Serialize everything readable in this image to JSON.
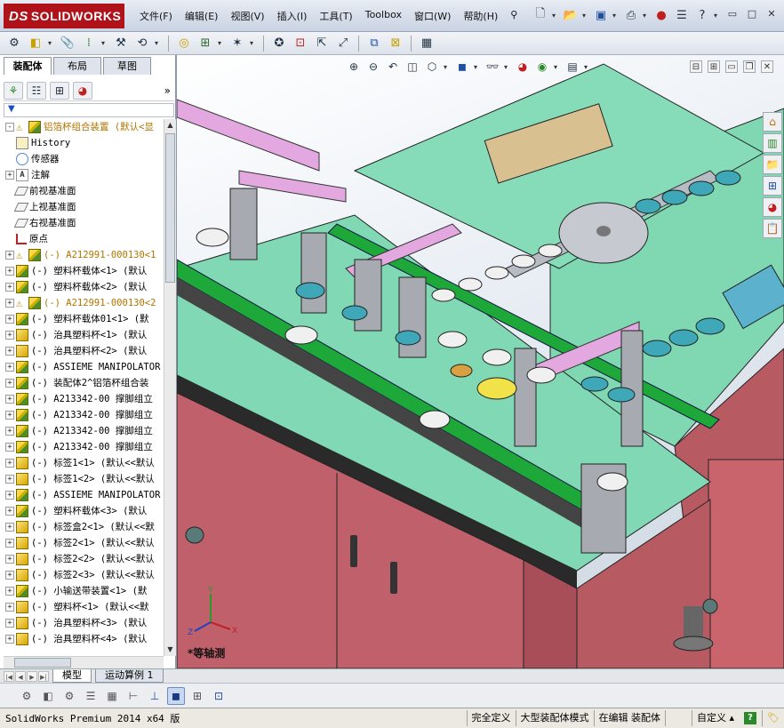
{
  "app": {
    "logo_text": "SOLIDWORKS",
    "logo_prefix": "DS"
  },
  "menu": [
    "文件(F)",
    "编辑(E)",
    "视图(V)",
    "插入(I)",
    "工具(T)",
    "Toolbox",
    "窗口(W)",
    "帮助(H)"
  ],
  "feature_manager": {
    "tabs": [
      "装配体",
      "布局",
      "草图"
    ],
    "filter_symbol": "▼",
    "tree": [
      {
        "label": "铝箔杯组合装置 (默认<显",
        "icon": "asm",
        "warn": true,
        "expand": "-",
        "top": true
      },
      {
        "label": "History",
        "icon": "hist",
        "expand": ""
      },
      {
        "label": "传感器",
        "icon": "sensor",
        "expand": ""
      },
      {
        "label": "注解",
        "icon": "annot",
        "expand": "+"
      },
      {
        "label": "前视基准面",
        "icon": "plane",
        "expand": ""
      },
      {
        "label": "上视基准面",
        "icon": "plane",
        "expand": ""
      },
      {
        "label": "右视基准面",
        "icon": "plane",
        "expand": ""
      },
      {
        "label": "原点",
        "icon": "origin",
        "expand": ""
      },
      {
        "label": "(-) A212991-000130<1",
        "icon": "asm",
        "warn": true,
        "expand": "+"
      },
      {
        "label": "(-) 塑料杯载体<1> (默认",
        "icon": "asm",
        "expand": "+"
      },
      {
        "label": "(-) 塑料杯载体<2> (默认",
        "icon": "asm",
        "expand": "+"
      },
      {
        "label": "(-) A212991-000130<2",
        "icon": "asm",
        "warn": true,
        "expand": "+"
      },
      {
        "label": "(-) 塑料杯载体01<1> (默",
        "icon": "asm",
        "expand": "+"
      },
      {
        "label": "(-) 治具塑料杯<1> (默认",
        "icon": "part",
        "expand": "+"
      },
      {
        "label": "(-) 治具塑料杯<2> (默认",
        "icon": "part",
        "expand": "+"
      },
      {
        "label": "(-) ASSIEME MANIPOLATOR",
        "icon": "asm",
        "expand": "+"
      },
      {
        "label": "(-) 装配体2^铝箔杯组合装",
        "icon": "asm",
        "expand": "+"
      },
      {
        "label": "(-) A213342-00 撑脚组立",
        "icon": "asm",
        "expand": "+"
      },
      {
        "label": "(-) A213342-00 撑脚组立",
        "icon": "asm",
        "expand": "+"
      },
      {
        "label": "(-) A213342-00 撑脚组立",
        "icon": "asm",
        "expand": "+"
      },
      {
        "label": "(-) A213342-00 撑脚组立",
        "icon": "asm",
        "expand": "+"
      },
      {
        "label": "(-) 标签1<1> (默认<<默认",
        "icon": "part",
        "expand": "+"
      },
      {
        "label": "(-) 标签1<2> (默认<<默认",
        "icon": "part",
        "expand": "+"
      },
      {
        "label": "(-) ASSIEME MANIPOLATOR",
        "icon": "asm",
        "expand": "+"
      },
      {
        "label": "(-) 塑料杯载体<3> (默认",
        "icon": "asm",
        "expand": "+"
      },
      {
        "label": "(-) 标签盒2<1> (默认<<默",
        "icon": "part",
        "expand": "+"
      },
      {
        "label": "(-) 标签2<1> (默认<<默认",
        "icon": "part",
        "expand": "+"
      },
      {
        "label": "(-) 标签2<2> (默认<<默认",
        "icon": "part",
        "expand": "+"
      },
      {
        "label": "(-) 标签2<3> (默认<<默认",
        "icon": "part",
        "expand": "+"
      },
      {
        "label": "(-) 小输送带装置<1> (默",
        "icon": "asm",
        "expand": "+"
      },
      {
        "label": "(-) 塑料杯<1> (默认<<默",
        "icon": "part",
        "expand": "+"
      },
      {
        "label": "(-) 治具塑料杯<3> (默认",
        "icon": "part",
        "expand": "+"
      },
      {
        "label": "(-) 治具塑料杯<4> (默认",
        "icon": "part",
        "expand": "+"
      }
    ]
  },
  "viewport": {
    "orientation": "*等轴测",
    "triad": {
      "x": "X",
      "y": "Y",
      "z": "Z"
    }
  },
  "bottom_tabs": [
    "模型",
    "运动算例 1"
  ],
  "statusbar": {
    "product": "SolidWorks Premium 2014 x64 版",
    "cells": [
      "完全定义",
      "大型装配体模式",
      "在编辑 装配体"
    ],
    "custom": "自定义",
    "help": "?"
  }
}
